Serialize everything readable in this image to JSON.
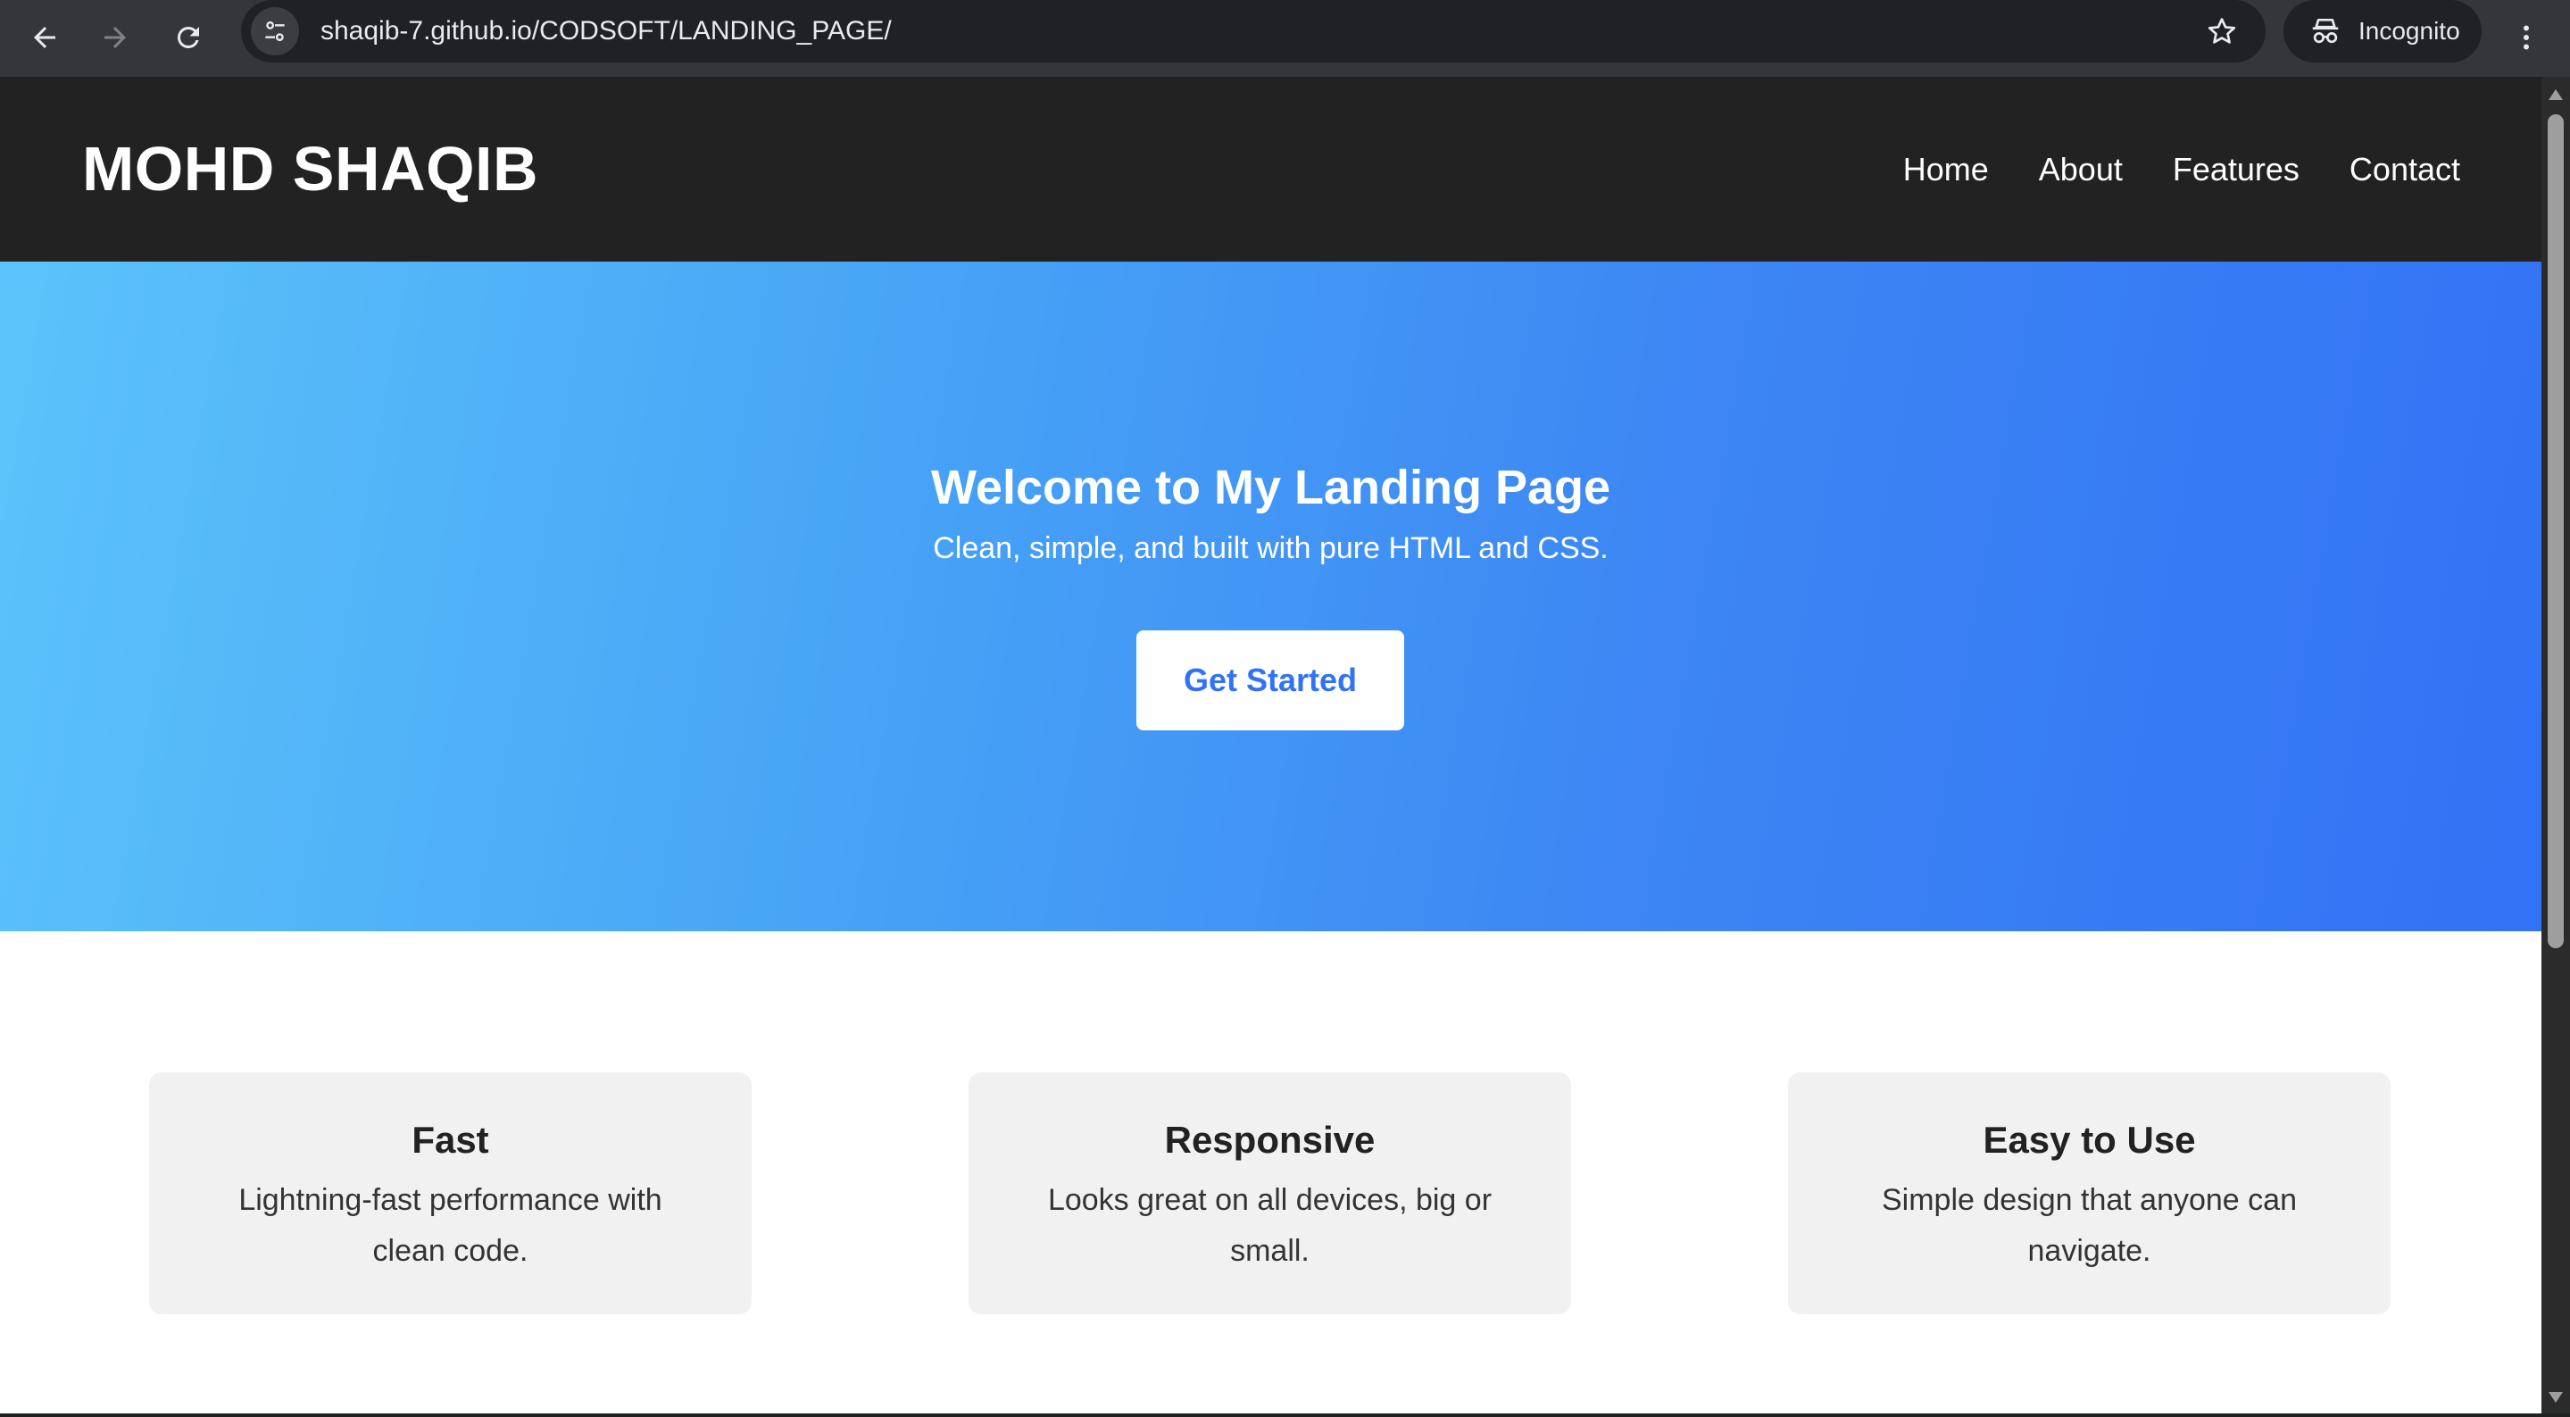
{
  "browser": {
    "url": "shaqib-7.github.io/CODSOFT/LANDING_PAGE/",
    "profile_label": "Incognito"
  },
  "site": {
    "logo": "MOHD SHAQIB",
    "nav": [
      "Home",
      "About",
      "Features",
      "Contact"
    ]
  },
  "hero": {
    "title": "Welcome to My Landing Page",
    "subtitle": "Clean, simple, and built with pure HTML and CSS.",
    "cta_label": "Get Started"
  },
  "features": [
    {
      "title": "Fast",
      "text": "Lightning-fast performance with clean code."
    },
    {
      "title": "Responsive",
      "text": "Looks great on all devices, big or small."
    },
    {
      "title": "Easy to Use",
      "text": "Simple design that anyone can navigate."
    }
  ],
  "colors": {
    "header_bg": "#222222",
    "hero_gradient_start": "#5cc3fa",
    "hero_gradient_end": "#3272f5",
    "card_bg": "#f1f1f1",
    "cta_text": "#3272f5"
  },
  "icons": {
    "back": "back-arrow-icon",
    "forward": "forward-arrow-icon",
    "reload": "reload-icon",
    "site_info": "tune-icon",
    "bookmark": "star-icon",
    "incognito": "incognito-icon",
    "menu": "kebab-menu-icon"
  }
}
